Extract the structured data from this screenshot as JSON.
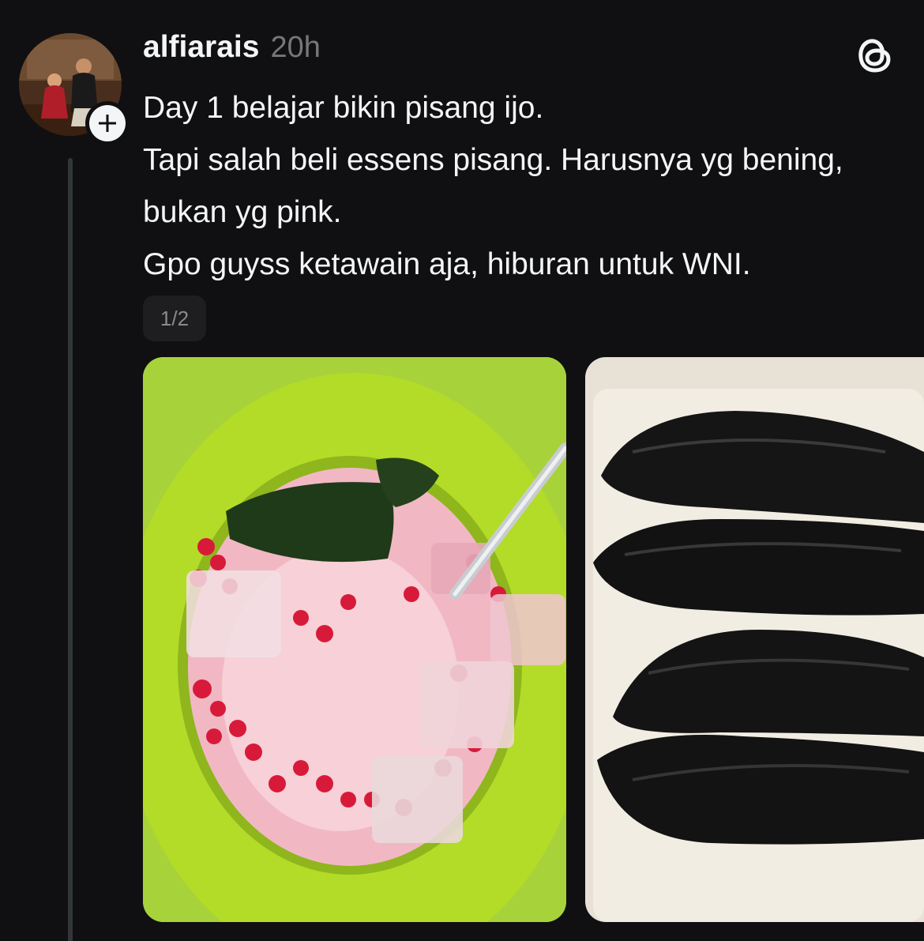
{
  "post": {
    "username": "alfiarais",
    "timestamp": "20h",
    "lines": [
      "Day 1 belajar bikin pisang ijo.",
      "Tapi salah beli essens pisang. Harusnya yg bening, bukan yg pink.",
      "Gpo guyss ketawain aja, hiburan untuk WNI."
    ],
    "media_counter": "1/2"
  },
  "icons": {
    "follow": "plus-icon",
    "app_logo": "threads-logo-icon"
  },
  "colors": {
    "background": "#101012",
    "text_primary": "#f3f5f7",
    "text_secondary": "#777777"
  }
}
